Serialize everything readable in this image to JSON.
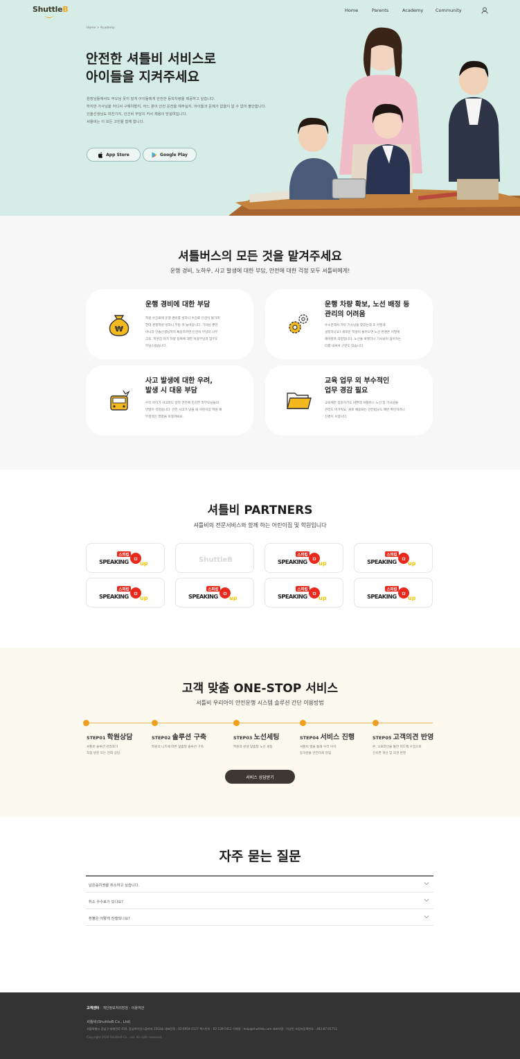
{
  "brand": {
    "logo_text": "Shuttle",
    "logo_accent": "B",
    "accent_color": "#f4a21b"
  },
  "nav": {
    "items": [
      "Home",
      "Parents",
      "Academy",
      "Community"
    ],
    "user_icon": "user-icon"
  },
  "hero": {
    "breadcrumb": "Home > Academy",
    "title_line1": "안전한 셔틀비 서비스로",
    "title_line2": "아이들을 지켜주세요",
    "desc": [
      "원장님들께서도 부모님 못지 않게 아이들에게 안전한 등학차량을 제공하고 싶습니다.",
      "하지만 가사님을 어디서 구해야할지, 어느 분이 안전 운전을 해주실지, 아이들과 문제가 없을지 알 수 없어 불안합니다.",
      "인솔선생님도 마찬가지, 인건비 부담이 커서 채용이 망설여집니다.",
      "셔틀비는 이 모든 고민을 함께 합니다."
    ],
    "app_store": "App Store",
    "google_play": "Google Play",
    "background": "#d6ece6"
  },
  "problems": {
    "title": "셔틀버스의 모든 것을 맡겨주세요",
    "subtitle": "운행 경비, 노하우, 사고 발생에 대한 부담, 안전에 대한 걱정 모두 셔틀비에게!",
    "cards": [
      {
        "icon": "money-bag-icon",
        "title": [
          "운행 경비에 대한 부담"
        ],
        "desc": [
          "학원 수강료에 운행 경비를 넣자니 수강료 인상이 불가피",
          "한데 경쟁학원 넣자니 부담 커 늘어납니다. 기사님 뿐만",
          "아니라 인솔선생님까지 채용하려면 인건비 부담이 너무",
          "크죠. 학원장 자가 차량 등록에 대한 비용부담과 업무도",
          "부담스럽습니다."
        ]
      },
      {
        "icon": "gears-icon",
        "title": [
          "운행 차량 확보, 노선 배정 등",
          "관리의 어려움"
        ],
        "desc": [
          "수소문해서 겨우 기사님을 찾았는데 또 어떻게",
          "설정하나요? 새로운 학생이 들어오면 노선 변경은 어떻게",
          "해야할까 걱정입니다. 노선을 바꿨더니 기사님이 싫어하는",
          "티를 내셔서 곤란도 있습니다."
        ]
      },
      {
        "icon": "bus-alert-icon",
        "title": [
          "사고 발생에 대한 우려,",
          "발생 시 대응 부담"
        ],
        "desc": [
          "우리 아이가 사고라도 날까 안전에 민감한 학부모님들의",
          "빈발이 걱정됩니다. 안전 사고가 났을 때 어린이집 학원 예",
          "부정적인 영향을 미칠까봐요."
        ]
      },
      {
        "icon": "folder-icon",
        "title": [
          "교육 업무 외 부수적인",
          "업무 경감 필요"
        ],
        "desc": [
          "교육에만 집중하기도 바쁜데 셔틀버스 노선 및 기사님을",
          "관리도 버거워요. 새로 채용되는 안전법규도 매번 확인하려니",
          "신경이 쓰입니다."
        ]
      }
    ]
  },
  "partners": {
    "title": "셔틀비 PARTNERS",
    "subtitle": "셔틀비의 전문서비스와 함께 하는 어린이집 및 학원입니다",
    "logos": [
      {
        "text": "SPEAKING",
        "badge": "스피킹",
        "up": "up",
        "style": "speaking"
      },
      {
        "text": "Shuttle",
        "accent": "B",
        "style": "shuttleb"
      },
      {
        "text": "SPEAKING",
        "badge": "스피킹",
        "up": "up",
        "style": "speaking"
      },
      {
        "text": "SPEAKING",
        "badge": "스피킹",
        "up": "up",
        "style": "speaking"
      },
      {
        "text": "SPEAKING",
        "badge": "스피킹",
        "up": "up",
        "style": "speaking"
      },
      {
        "text": "SPEAKING",
        "badge": "스피킹",
        "up": "up",
        "style": "speaking"
      },
      {
        "text": "SPEAKING",
        "badge": "스피킹",
        "up": "up",
        "style": "speaking"
      },
      {
        "text": "SPEAKING",
        "badge": "스피킹",
        "up": "up",
        "style": "speaking"
      }
    ]
  },
  "onestop": {
    "title": "고객 맞춤 ONE-STOP 서비스",
    "subtitle": "셔틀비 우리아이 안전운행 시스템 솔루션 간단 이용방법",
    "steps": [
      {
        "step": "STEP01",
        "label": "학원상담",
        "desc": [
          "셔틀비 솔루션 관리자가",
          "직접 방문 또는 전화 상담"
        ]
      },
      {
        "step": "STEP02",
        "label": "솔루션 구축",
        "desc": [
          "학원의 니즈에 따른 맞춤형 솔루션 구축"
        ]
      },
      {
        "step": "STEP03",
        "label": "노선세팅",
        "desc": [
          "학원과 원생 맞춤형 노선 세팅"
        ]
      },
      {
        "step": "STEP04",
        "label": "서비스 진행",
        "desc": [
          "셔틀비 앱을 통해 우리 아이",
          "등하원을 안전하게 알림"
        ]
      },
      {
        "step": "STEP05",
        "label": "고객의견 반영",
        "desc": [
          "온, 오프라인을 통한 피드백 수집으로",
          "신속한 개선 및 의견 반영"
        ]
      }
    ],
    "cta": "서비스 상담받기",
    "background": "#fcf9ef"
  },
  "faq": {
    "title": "자주 묻는 질문",
    "items": [
      "남은승차권을 취소하고 싶습니다.",
      "취소 수수료가 있나요?",
      "환불은 어떻게 진행되나요?"
    ]
  },
  "footer": {
    "links": [
      "고객센터",
      "개인정보처리방침",
      "이용약관"
    ],
    "company": "셔틀비(ShuttleB Co., Ltd)",
    "address": "서울특별시 강남구 테헤란로 419, 강남파이낸스플라자 1503호 대표전화 : 02-6954-0127 팩스번호 : 02-539-5412 이메일 : help@shuttleb.com 대표자명 : 이상빈 사업자등록번호 : 483-87-01753",
    "copyright": "Copyright 2020 ShuttleB Co., Ltd. All right reserved.",
    "background": "#333333"
  }
}
